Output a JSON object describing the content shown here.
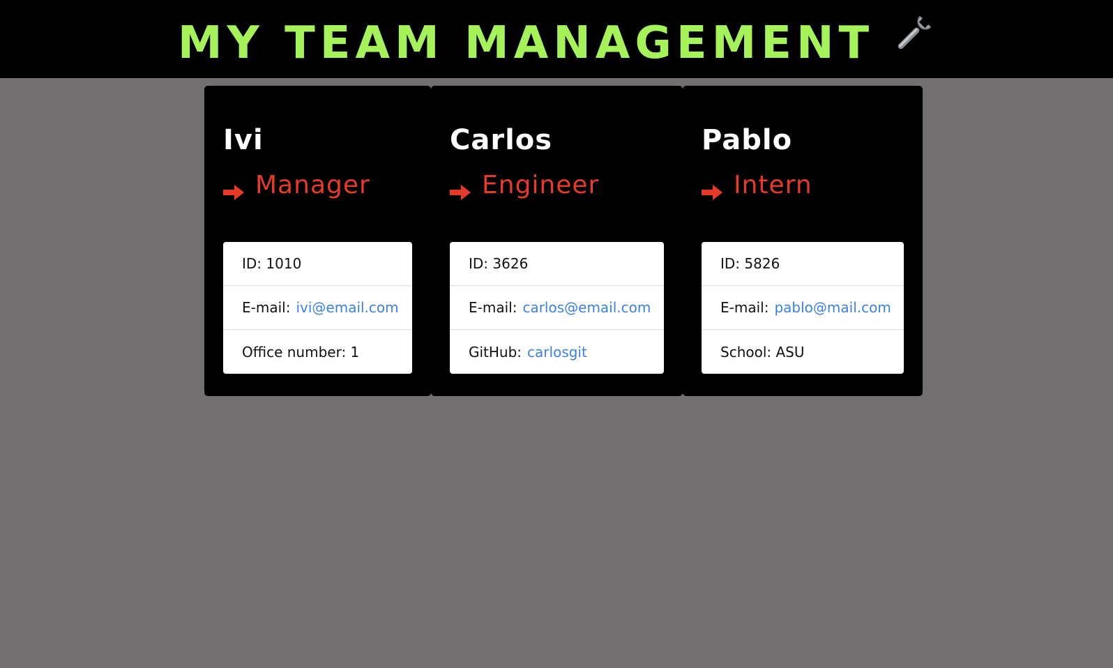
{
  "header": {
    "title": "My Team Management"
  },
  "colors": {
    "title": "#a6f25b",
    "role": "#e63b28",
    "link": "#3b82e0",
    "background": "#727071",
    "card": "#000000"
  },
  "icons": {
    "header": "wrench-icon",
    "role": "arrow-right-icon"
  },
  "employees": [
    {
      "name": "Ivi",
      "role": "Manager",
      "id_label": "ID: 1010",
      "email_label": "E-mail:",
      "email": "ivi@email.com",
      "extra_label": "Office number: 1",
      "extra_link": ""
    },
    {
      "name": "Carlos",
      "role": "Engineer",
      "id_label": "ID: 3626",
      "email_label": "E-mail:",
      "email": "carlos@email.com",
      "extra_label": "GitHub:",
      "extra_link": "carlosgit"
    },
    {
      "name": "Pablo",
      "role": "Intern",
      "id_label": "ID: 5826",
      "email_label": "E-mail:",
      "email": "pablo@mail.com",
      "extra_label": "School: ASU",
      "extra_link": ""
    }
  ]
}
